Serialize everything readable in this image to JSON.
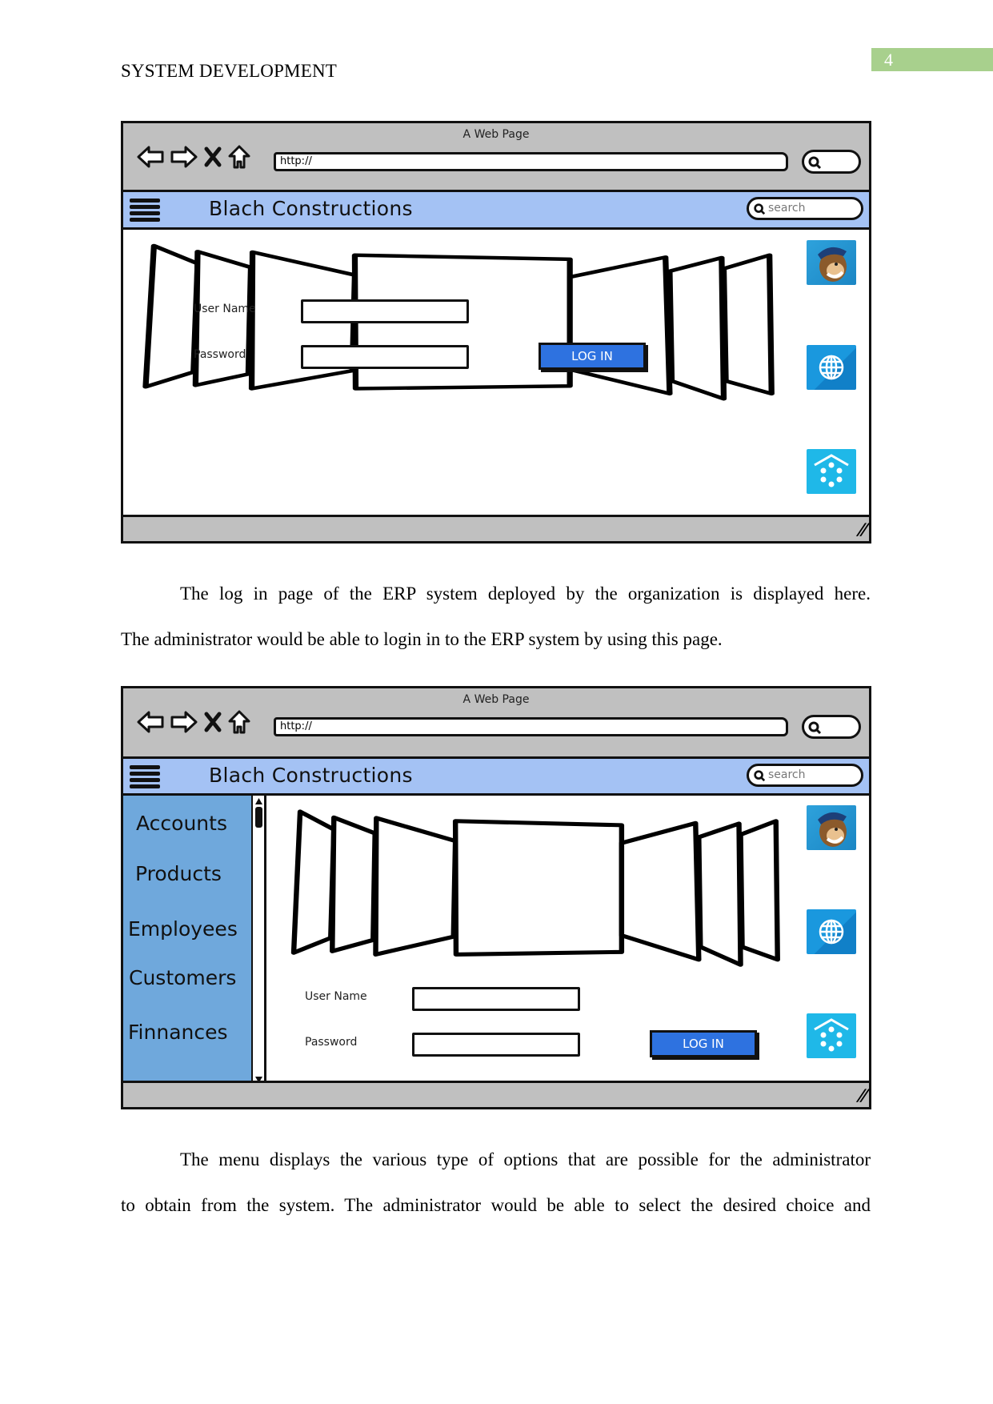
{
  "document": {
    "running_head": "SYSTEM DEVELOPMENT",
    "page_number": "4",
    "page_number_color": "#a8d08d"
  },
  "mockups": [
    {
      "browser": {
        "page_title": "A Web Page",
        "url": "http://",
        "nav_icons": [
          "back-arrow-icon",
          "forward-arrow-icon",
          "stop-icon",
          "home-icon"
        ]
      },
      "app": {
        "title": "Blach Constructions",
        "search_placeholder": "search",
        "header_color": "#a4c2f4"
      },
      "form": {
        "username_label": "User Name",
        "password_label": "Password",
        "username_value": "",
        "password_value": "",
        "login_label": "LOG IN",
        "login_color": "#2e72e0"
      },
      "side_icons": [
        "mailchimp-monkey-icon",
        "globe-icon",
        "launcher-home-icon"
      ]
    },
    {
      "browser": {
        "page_title": "A Web Page",
        "url": "http://",
        "nav_icons": [
          "back-arrow-icon",
          "forward-arrow-icon",
          "stop-icon",
          "home-icon"
        ]
      },
      "app": {
        "title": "Blach Constructions",
        "search_placeholder": "search",
        "header_color": "#a4c2f4"
      },
      "sidebar": {
        "color": "#6fa8dc",
        "items": [
          {
            "label": "Accounts"
          },
          {
            "label": "Products"
          },
          {
            "label": "Employees"
          },
          {
            "label": "Customers"
          },
          {
            "label": "Finnances"
          }
        ]
      },
      "form": {
        "username_label": "User Name",
        "password_label": "Password",
        "username_value": "",
        "password_value": "",
        "login_label": "LOG IN",
        "login_color": "#2e72e0"
      },
      "side_icons": [
        "mailchimp-monkey-icon",
        "globe-icon",
        "launcher-home-icon"
      ]
    }
  ],
  "paragraphs": [
    {
      "lines": [
        "The log in page of the ERP system deployed by the organization is displayed here.",
        "The administrator would be able to login in to the ERP system by using this page."
      ]
    },
    {
      "lines": [
        "The menu displays the various type of options that are possible for the administrator",
        "to obtain from the system. The administrator would be able to select the desired choice and"
      ]
    }
  ]
}
